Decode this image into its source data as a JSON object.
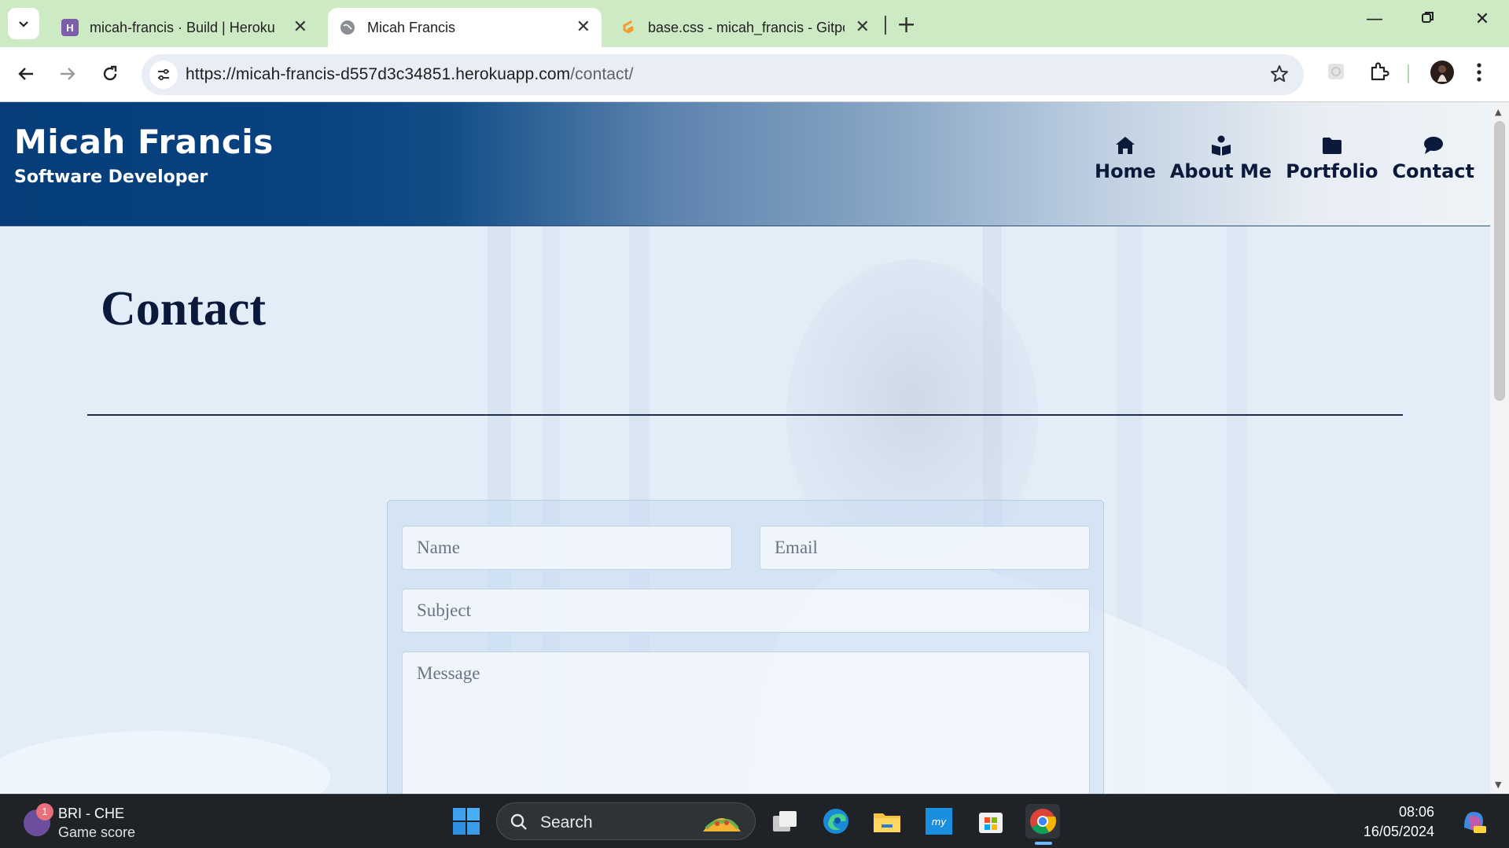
{
  "browser": {
    "tabs": [
      {
        "title": "micah-francis · Build | Heroku",
        "favicon": "heroku-icon",
        "active": false
      },
      {
        "title": "Micah Francis",
        "favicon": "globe-icon",
        "active": true
      },
      {
        "title": "base.css - micah_francis - Gitpod",
        "favicon": "gitpod-icon",
        "active": false
      }
    ],
    "new_tab_label": "+",
    "url_host": "https://micah-francis-d557d3c34851.herokuapp.com",
    "url_path": "/contact/"
  },
  "site": {
    "brand_name": "Micah Francis",
    "brand_tagline": "Software Developer",
    "nav": [
      {
        "label": "Home",
        "icon": "home-icon"
      },
      {
        "label": "About Me",
        "icon": "reader-icon"
      },
      {
        "label": "Portfolio",
        "icon": "folder-icon"
      },
      {
        "label": "Contact",
        "icon": "chat-bubble-icon"
      }
    ],
    "page_title": "Contact",
    "form": {
      "name_placeholder": "Name",
      "email_placeholder": "Email",
      "subject_placeholder": "Subject",
      "message_placeholder": "Message"
    }
  },
  "taskbar": {
    "widget_badge": "1",
    "widget_title": "BRI - CHE",
    "widget_subtitle": "Game score",
    "search_label": "Search",
    "time": "08:06",
    "date": "16/05/2024"
  },
  "colors": {
    "tabstrip": "#cdeac4",
    "header_dark": "#063d7a",
    "text_navy": "#0b1a3b",
    "taskbar": "#1f2328"
  }
}
